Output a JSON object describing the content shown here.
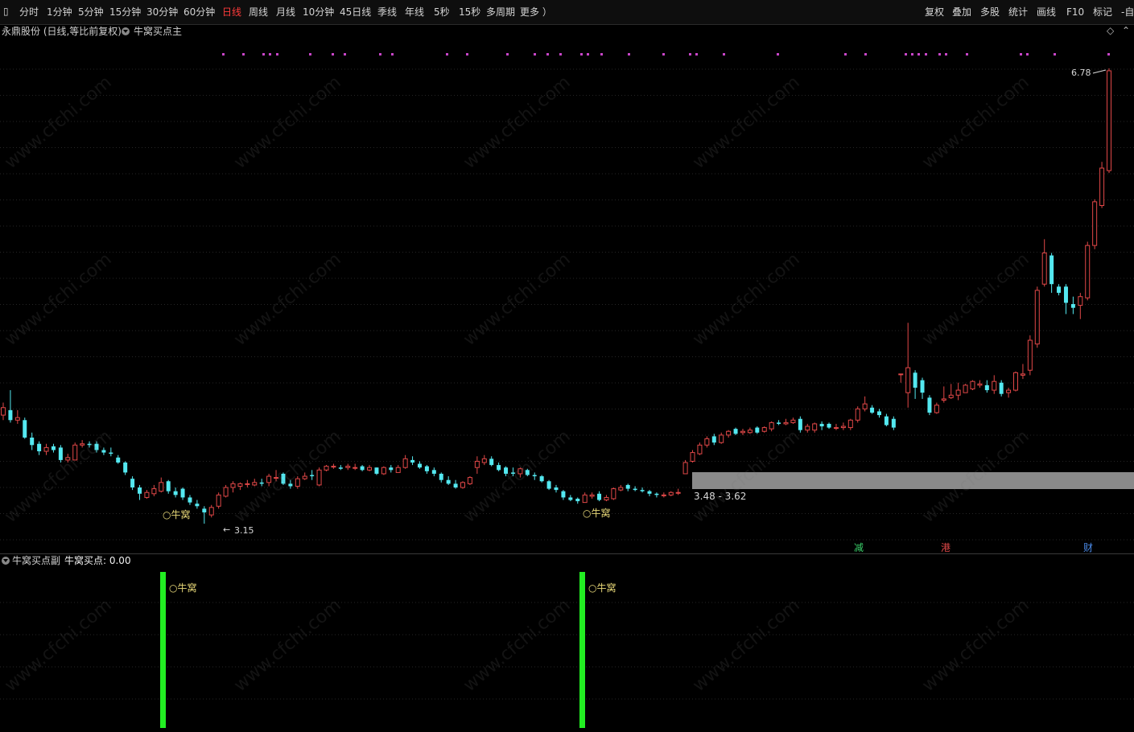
{
  "toolbar": {
    "left_items": [
      "分时",
      "1分钟",
      "5分钟",
      "15分钟",
      "30分钟",
      "60分钟",
      "日线",
      "周线",
      "月线",
      "10分钟",
      "45日线",
      "季线",
      "年线",
      "5秒",
      "15秒",
      "多周期",
      "更多 ）"
    ],
    "active_item": "日线",
    "right_items": [
      "复权",
      "叠加",
      "多股",
      "统计",
      "画线",
      "F10",
      "标记",
      "-自"
    ]
  },
  "main_header": {
    "stock_title": "永鼎股份 (日线,等比前复权)",
    "indicator_name": "牛窝买点主"
  },
  "price_labels": {
    "high": "6.78",
    "low": "3.15",
    "range": "3.48 - 3.62"
  },
  "signal_label": "○牛窝",
  "event_badges": {
    "jian": "减",
    "gang": "港",
    "cai": "财"
  },
  "sub_header": {
    "indicator_name": "牛窝买点副",
    "value_label": "牛窝买点: 0.00"
  },
  "watermark": "www.cfchi.com",
  "colors": {
    "up": "#e24848",
    "down": "#54e8f0",
    "signal_bar": "#22ee22",
    "zone": "#8a8a8a",
    "marker_dots": "#c845c8",
    "active_tab": "#ff3b3b"
  },
  "chart_data": {
    "type": "candlestick",
    "price_range": [
      3.15,
      6.78
    ],
    "candles": [
      {
        "o": 4.02,
        "c": 4.08,
        "h": 4.12,
        "l": 3.98
      },
      {
        "o": 4.06,
        "c": 3.98,
        "h": 4.22,
        "l": 3.96
      },
      {
        "o": 3.98,
        "c": 4.0,
        "h": 4.06,
        "l": 3.95
      },
      {
        "o": 3.98,
        "c": 3.84,
        "h": 4.0,
        "l": 3.83
      },
      {
        "o": 3.84,
        "c": 3.78,
        "h": 3.88,
        "l": 3.74
      },
      {
        "o": 3.79,
        "c": 3.73,
        "h": 3.81,
        "l": 3.7
      },
      {
        "o": 3.73,
        "c": 3.76,
        "h": 3.79,
        "l": 3.7
      },
      {
        "o": 3.77,
        "c": 3.74,
        "h": 3.79,
        "l": 3.72
      },
      {
        "o": 3.76,
        "c": 3.66,
        "h": 3.78,
        "l": 3.64
      },
      {
        "o": 3.66,
        "c": 3.68,
        "h": 3.71,
        "l": 3.64
      },
      {
        "o": 3.66,
        "c": 3.78,
        "h": 3.8,
        "l": 3.66
      },
      {
        "o": 3.78,
        "c": 3.79,
        "h": 3.82,
        "l": 3.76
      },
      {
        "o": 3.79,
        "c": 3.78,
        "h": 3.81,
        "l": 3.76
      },
      {
        "o": 3.79,
        "c": 3.74,
        "h": 3.81,
        "l": 3.72
      },
      {
        "o": 3.74,
        "c": 3.72,
        "h": 3.76,
        "l": 3.7
      },
      {
        "o": 3.72,
        "c": 3.71,
        "h": 3.76,
        "l": 3.69
      },
      {
        "o": 3.68,
        "c": 3.64,
        "h": 3.7,
        "l": 3.63
      },
      {
        "o": 3.64,
        "c": 3.56,
        "h": 3.65,
        "l": 3.54
      },
      {
        "o": 3.51,
        "c": 3.44,
        "h": 3.53,
        "l": 3.42
      },
      {
        "o": 3.44,
        "c": 3.39,
        "h": 3.46,
        "l": 3.34
      },
      {
        "o": 3.36,
        "c": 3.4,
        "h": 3.42,
        "l": 3.35
      },
      {
        "o": 3.39,
        "c": 3.43,
        "h": 3.46,
        "l": 3.37
      },
      {
        "o": 3.41,
        "c": 3.48,
        "h": 3.52,
        "l": 3.4
      },
      {
        "o": 3.49,
        "c": 3.41,
        "h": 3.5,
        "l": 3.39
      },
      {
        "o": 3.41,
        "c": 3.38,
        "h": 3.44,
        "l": 3.36
      },
      {
        "o": 3.43,
        "c": 3.36,
        "h": 3.44,
        "l": 3.34
      },
      {
        "o": 3.36,
        "c": 3.32,
        "h": 3.38,
        "l": 3.3
      },
      {
        "o": 3.31,
        "c": 3.29,
        "h": 3.34,
        "l": 3.27
      },
      {
        "o": 3.27,
        "c": 3.24,
        "h": 3.29,
        "l": 3.15
      },
      {
        "o": 3.22,
        "c": 3.28,
        "h": 3.3,
        "l": 3.2
      },
      {
        "o": 3.29,
        "c": 3.38,
        "h": 3.4,
        "l": 3.27
      },
      {
        "o": 3.37,
        "c": 3.44,
        "h": 3.46,
        "l": 3.36
      },
      {
        "o": 3.44,
        "c": 3.47,
        "h": 3.49,
        "l": 3.4
      },
      {
        "o": 3.45,
        "c": 3.47,
        "h": 3.48,
        "l": 3.42
      },
      {
        "o": 3.47,
        "c": 3.47,
        "h": 3.5,
        "l": 3.44
      },
      {
        "o": 3.46,
        "c": 3.48,
        "h": 3.51,
        "l": 3.45
      },
      {
        "o": 3.48,
        "c": 3.47,
        "h": 3.51,
        "l": 3.45
      },
      {
        "o": 3.48,
        "c": 3.53,
        "h": 3.55,
        "l": 3.45
      },
      {
        "o": 3.52,
        "c": 3.52,
        "h": 3.58,
        "l": 3.49
      },
      {
        "o": 3.55,
        "c": 3.47,
        "h": 3.56,
        "l": 3.46
      },
      {
        "o": 3.47,
        "c": 3.45,
        "h": 3.5,
        "l": 3.43
      },
      {
        "o": 3.45,
        "c": 3.51,
        "h": 3.53,
        "l": 3.43
      },
      {
        "o": 3.51,
        "c": 3.53,
        "h": 3.56,
        "l": 3.5
      },
      {
        "o": 3.54,
        "c": 3.53,
        "h": 3.58,
        "l": 3.5
      },
      {
        "o": 3.46,
        "c": 3.58,
        "h": 3.6,
        "l": 3.45
      },
      {
        "o": 3.58,
        "c": 3.61,
        "h": 3.62,
        "l": 3.57
      },
      {
        "o": 3.61,
        "c": 3.61,
        "h": 3.63,
        "l": 3.59
      },
      {
        "o": 3.6,
        "c": 3.59,
        "h": 3.62,
        "l": 3.58
      },
      {
        "o": 3.6,
        "c": 3.61,
        "h": 3.63,
        "l": 3.58
      },
      {
        "o": 3.6,
        "c": 3.6,
        "h": 3.63,
        "l": 3.58
      },
      {
        "o": 3.61,
        "c": 3.58,
        "h": 3.62,
        "l": 3.57
      },
      {
        "o": 3.58,
        "c": 3.6,
        "h": 3.62,
        "l": 3.57
      },
      {
        "o": 3.6,
        "c": 3.55,
        "h": 3.6,
        "l": 3.54
      },
      {
        "o": 3.55,
        "c": 3.6,
        "h": 3.61,
        "l": 3.54
      },
      {
        "o": 3.6,
        "c": 3.58,
        "h": 3.62,
        "l": 3.56
      },
      {
        "o": 3.56,
        "c": 3.6,
        "h": 3.62,
        "l": 3.56
      },
      {
        "o": 3.6,
        "c": 3.67,
        "h": 3.7,
        "l": 3.59
      },
      {
        "o": 3.66,
        "c": 3.64,
        "h": 3.69,
        "l": 3.62
      },
      {
        "o": 3.63,
        "c": 3.6,
        "h": 3.65,
        "l": 3.59
      },
      {
        "o": 3.61,
        "c": 3.57,
        "h": 3.62,
        "l": 3.55
      },
      {
        "o": 3.58,
        "c": 3.55,
        "h": 3.6,
        "l": 3.53
      },
      {
        "o": 3.55,
        "c": 3.5,
        "h": 3.56,
        "l": 3.48
      },
      {
        "o": 3.5,
        "c": 3.47,
        "h": 3.53,
        "l": 3.46
      },
      {
        "o": 3.47,
        "c": 3.44,
        "h": 3.5,
        "l": 3.43
      },
      {
        "o": 3.44,
        "c": 3.48,
        "h": 3.49,
        "l": 3.43
      },
      {
        "o": 3.47,
        "c": 3.52,
        "h": 3.53,
        "l": 3.46
      },
      {
        "o": 3.6,
        "c": 3.65,
        "h": 3.69,
        "l": 3.55
      },
      {
        "o": 3.64,
        "c": 3.67,
        "h": 3.7,
        "l": 3.62
      },
      {
        "o": 3.67,
        "c": 3.62,
        "h": 3.69,
        "l": 3.61
      },
      {
        "o": 3.62,
        "c": 3.58,
        "h": 3.64,
        "l": 3.57
      },
      {
        "o": 3.6,
        "c": 3.55,
        "h": 3.61,
        "l": 3.53
      },
      {
        "o": 3.56,
        "c": 3.55,
        "h": 3.6,
        "l": 3.53
      },
      {
        "o": 3.55,
        "c": 3.59,
        "h": 3.6,
        "l": 3.52
      },
      {
        "o": 3.58,
        "c": 3.54,
        "h": 3.59,
        "l": 3.53
      },
      {
        "o": 3.54,
        "c": 3.53,
        "h": 3.56,
        "l": 3.5
      },
      {
        "o": 3.53,
        "c": 3.49,
        "h": 3.54,
        "l": 3.48
      },
      {
        "o": 3.49,
        "c": 3.43,
        "h": 3.5,
        "l": 3.42
      },
      {
        "o": 3.44,
        "c": 3.42,
        "h": 3.46,
        "l": 3.4
      },
      {
        "o": 3.41,
        "c": 3.36,
        "h": 3.42,
        "l": 3.34
      },
      {
        "o": 3.36,
        "c": 3.34,
        "h": 3.38,
        "l": 3.33
      },
      {
        "o": 3.35,
        "c": 3.33,
        "h": 3.36,
        "l": 3.31
      },
      {
        "o": 3.32,
        "c": 3.38,
        "h": 3.4,
        "l": 3.32
      },
      {
        "o": 3.37,
        "c": 3.38,
        "h": 3.4,
        "l": 3.35
      },
      {
        "o": 3.39,
        "c": 3.34,
        "h": 3.41,
        "l": 3.33
      },
      {
        "o": 3.34,
        "c": 3.36,
        "h": 3.38,
        "l": 3.33
      },
      {
        "o": 3.35,
        "c": 3.43,
        "h": 3.44,
        "l": 3.34
      },
      {
        "o": 3.42,
        "c": 3.44,
        "h": 3.46,
        "l": 3.41
      },
      {
        "o": 3.46,
        "c": 3.43,
        "h": 3.47,
        "l": 3.41
      },
      {
        "o": 3.43,
        "c": 3.42,
        "h": 3.45,
        "l": 3.41
      },
      {
        "o": 3.42,
        "c": 3.41,
        "h": 3.44,
        "l": 3.4
      },
      {
        "o": 3.41,
        "c": 3.39,
        "h": 3.42,
        "l": 3.37
      },
      {
        "o": 3.39,
        "c": 3.38,
        "h": 3.4,
        "l": 3.36
      },
      {
        "o": 3.38,
        "c": 3.38,
        "h": 3.4,
        "l": 3.36
      },
      {
        "o": 3.38,
        "c": 3.4,
        "h": 3.41,
        "l": 3.37
      },
      {
        "o": 3.4,
        "c": 3.4,
        "h": 3.43,
        "l": 3.38
      },
      {
        "o": 3.55,
        "c": 3.64,
        "h": 3.66,
        "l": 3.55
      },
      {
        "o": 3.65,
        "c": 3.72,
        "h": 3.74,
        "l": 3.64
      },
      {
        "o": 3.71,
        "c": 3.78,
        "h": 3.8,
        "l": 3.7
      },
      {
        "o": 3.78,
        "c": 3.83,
        "h": 3.85,
        "l": 3.76
      },
      {
        "o": 3.85,
        "c": 3.8,
        "h": 3.87,
        "l": 3.78
      },
      {
        "o": 3.8,
        "c": 3.86,
        "h": 3.88,
        "l": 3.79
      },
      {
        "o": 3.86,
        "c": 3.89,
        "h": 3.9,
        "l": 3.84
      },
      {
        "o": 3.91,
        "c": 3.87,
        "h": 3.92,
        "l": 3.86
      },
      {
        "o": 3.88,
        "c": 3.89,
        "h": 3.91,
        "l": 3.86
      },
      {
        "o": 3.88,
        "c": 3.9,
        "h": 3.92,
        "l": 3.87
      },
      {
        "o": 3.92,
        "c": 3.88,
        "h": 3.93,
        "l": 3.87
      },
      {
        "o": 3.89,
        "c": 3.92,
        "h": 3.93,
        "l": 3.88
      },
      {
        "o": 3.91,
        "c": 3.96,
        "h": 3.97,
        "l": 3.89
      },
      {
        "o": 3.96,
        "c": 3.95,
        "h": 3.98,
        "l": 3.94
      },
      {
        "o": 3.95,
        "c": 3.96,
        "h": 3.99,
        "l": 3.94
      },
      {
        "o": 3.96,
        "c": 3.98,
        "h": 4.0,
        "l": 3.95
      },
      {
        "o": 3.99,
        "c": 3.9,
        "h": 4.01,
        "l": 3.88
      },
      {
        "o": 3.9,
        "c": 3.93,
        "h": 3.95,
        "l": 3.88
      },
      {
        "o": 3.9,
        "c": 3.95,
        "h": 3.96,
        "l": 3.88
      },
      {
        "o": 3.95,
        "c": 3.93,
        "h": 3.97,
        "l": 3.9
      },
      {
        "o": 3.95,
        "c": 3.92,
        "h": 3.96,
        "l": 3.91
      },
      {
        "o": 3.92,
        "c": 3.92,
        "h": 3.95,
        "l": 3.9
      },
      {
        "o": 3.92,
        "c": 3.93,
        "h": 3.96,
        "l": 3.9
      },
      {
        "o": 3.92,
        "c": 3.98,
        "h": 3.99,
        "l": 3.9
      },
      {
        "o": 3.98,
        "c": 4.07,
        "h": 4.09,
        "l": 3.96
      },
      {
        "o": 4.07,
        "c": 4.11,
        "h": 4.17,
        "l": 4.05
      },
      {
        "o": 4.08,
        "c": 4.04,
        "h": 4.1,
        "l": 4.03
      },
      {
        "o": 4.05,
        "c": 4.02,
        "h": 4.07,
        "l": 4.0
      },
      {
        "o": 4.01,
        "c": 3.94,
        "h": 4.03,
        "l": 3.93
      },
      {
        "o": 3.99,
        "c": 3.92,
        "h": 4.01,
        "l": 3.9
      },
      {
        "o": 4.35,
        "c": 4.35,
        "h": 4.35,
        "l": 4.28
      },
      {
        "o": 4.2,
        "c": 4.4,
        "h": 4.76,
        "l": 4.08
      },
      {
        "o": 4.36,
        "c": 4.24,
        "h": 4.38,
        "l": 4.15
      },
      {
        "o": 4.3,
        "c": 4.2,
        "h": 4.32,
        "l": 4.15
      },
      {
        "o": 4.16,
        "c": 4.04,
        "h": 4.18,
        "l": 4.02
      },
      {
        "o": 4.04,
        "c": 4.1,
        "h": 4.12,
        "l": 4.03
      },
      {
        "o": 4.14,
        "c": 4.15,
        "h": 4.25,
        "l": 4.12
      },
      {
        "o": 4.16,
        "c": 4.18,
        "h": 4.27,
        "l": 4.15
      },
      {
        "o": 4.18,
        "c": 4.22,
        "h": 4.28,
        "l": 4.14
      },
      {
        "o": 4.2,
        "c": 4.26,
        "h": 4.27,
        "l": 4.2
      },
      {
        "o": 4.23,
        "c": 4.29,
        "h": 4.3,
        "l": 4.22
      },
      {
        "o": 4.26,
        "c": 4.27,
        "h": 4.3,
        "l": 4.24
      },
      {
        "o": 4.26,
        "c": 4.22,
        "h": 4.3,
        "l": 4.2
      },
      {
        "o": 4.22,
        "c": 4.29,
        "h": 4.34,
        "l": 4.19
      },
      {
        "o": 4.28,
        "c": 4.19,
        "h": 4.3,
        "l": 4.17
      },
      {
        "o": 4.2,
        "c": 4.22,
        "h": 4.24,
        "l": 4.16
      },
      {
        "o": 4.22,
        "c": 4.36,
        "h": 4.37,
        "l": 4.21
      },
      {
        "o": 4.34,
        "c": 4.35,
        "h": 4.43,
        "l": 4.31
      },
      {
        "o": 4.38,
        "c": 4.62,
        "h": 4.66,
        "l": 4.34
      },
      {
        "o": 4.59,
        "c": 5.02,
        "h": 5.05,
        "l": 4.56
      },
      {
        "o": 5.07,
        "c": 5.32,
        "h": 5.43,
        "l": 5.05
      },
      {
        "o": 5.3,
        "c": 5.07,
        "h": 5.32,
        "l": 5.0
      },
      {
        "o": 5.05,
        "c": 5.0,
        "h": 5.07,
        "l": 4.98
      },
      {
        "o": 5.05,
        "c": 4.92,
        "h": 5.07,
        "l": 4.83
      },
      {
        "o": 4.91,
        "c": 4.88,
        "h": 4.97,
        "l": 4.83
      },
      {
        "o": 4.9,
        "c": 4.97,
        "h": 5.0,
        "l": 4.79
      },
      {
        "o": 4.96,
        "c": 5.38,
        "h": 5.41,
        "l": 4.94
      },
      {
        "o": 5.38,
        "c": 5.73,
        "h": 5.75,
        "l": 5.35
      },
      {
        "o": 5.7,
        "c": 6.0,
        "h": 6.05,
        "l": 5.68
      },
      {
        "o": 5.98,
        "c": 6.78,
        "h": 6.8,
        "l": 5.96
      }
    ],
    "signal_bars": [
      {
        "candle_index": 23,
        "value": 1
      },
      {
        "candle_index": 82,
        "value": 1
      }
    ],
    "indicator_value": 0.0
  }
}
